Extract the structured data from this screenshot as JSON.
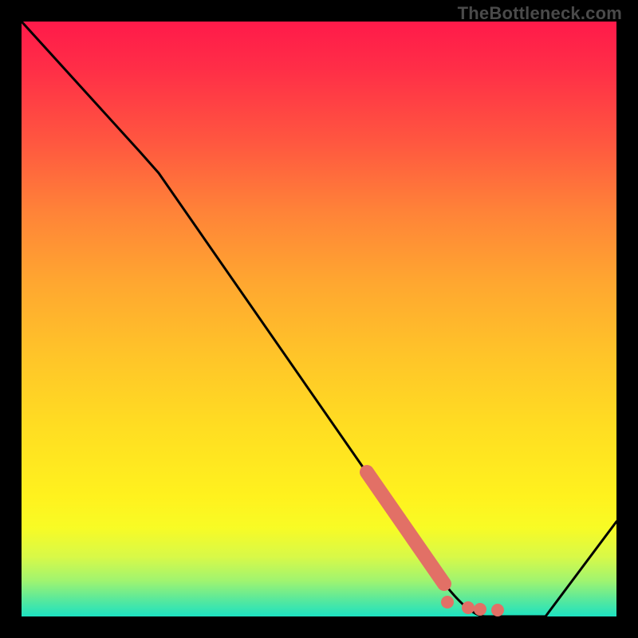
{
  "watermark": "TheBottleneck.com",
  "chart_data": {
    "type": "line",
    "title": "",
    "xlabel": "",
    "ylabel": "",
    "xlim": [
      0,
      100
    ],
    "ylim": [
      0,
      100
    ],
    "line": {
      "name": "bottleneck-curve",
      "x": [
        0,
        20,
        23,
        70,
        78,
        88,
        100
      ],
      "y": [
        100,
        78,
        75,
        7,
        0,
        0,
        16
      ]
    },
    "highlight_segment": {
      "name": "highlight",
      "color": "#e27066",
      "x": [
        58,
        71
      ],
      "y": [
        24.3,
        5.5
      ]
    },
    "highlight_dots": {
      "name": "dots",
      "color": "#e27066",
      "points": [
        {
          "x": 71.5,
          "y": 2.4
        },
        {
          "x": 75,
          "y": 1.5
        },
        {
          "x": 77,
          "y": 1.2
        },
        {
          "x": 80,
          "y": 1.0
        }
      ]
    },
    "gradient_stops": [
      {
        "pos": 0,
        "color": "#ff1a4a"
      },
      {
        "pos": 20,
        "color": "#ff5640"
      },
      {
        "pos": 44,
        "color": "#ffa730"
      },
      {
        "pos": 68,
        "color": "#ffdd22"
      },
      {
        "pos": 85,
        "color": "#f8fb25"
      },
      {
        "pos": 97,
        "color": "#5ce99a"
      },
      {
        "pos": 100,
        "color": "#1de2c1"
      }
    ]
  }
}
